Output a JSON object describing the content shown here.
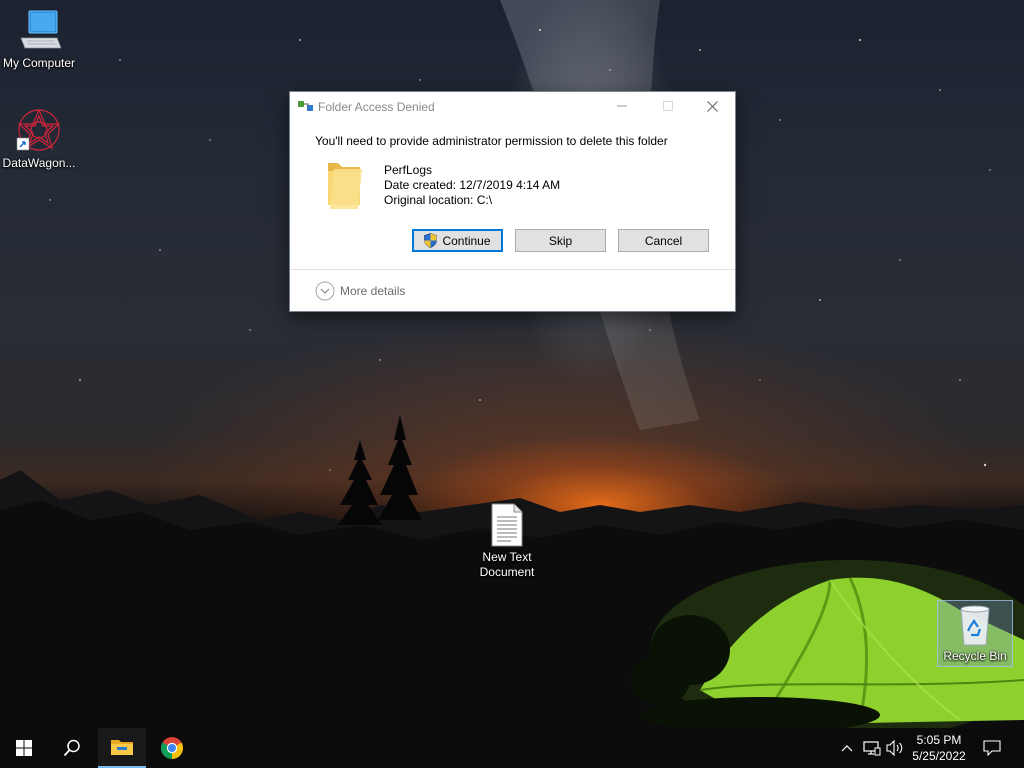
{
  "desktop": {
    "icons": [
      {
        "label": "My Computer",
        "icon": "computer-icon"
      },
      {
        "label": "DataWagon...",
        "icon": "datawagon-shortcut-icon"
      },
      {
        "label": "New Text Document",
        "label_line1": "New Text",
        "label_line2": "Document",
        "icon": "text-document-icon"
      },
      {
        "label": "Recycle Bin",
        "icon": "recycle-bin-icon",
        "selected": true
      }
    ]
  },
  "dialog": {
    "title": "Folder Access Denied",
    "message": "You'll need to provide administrator permission to delete this folder",
    "item": {
      "name": "PerfLogs",
      "date_created": "Date created: 12/7/2019 4:14 AM",
      "original_location": "Original location: C:\\"
    },
    "buttons": {
      "continue": "Continue",
      "skip": "Skip",
      "cancel": "Cancel"
    },
    "more_details": "More details",
    "colors": {
      "accent": "#0078d7"
    }
  },
  "taskbar": {
    "pinned": [
      "start-icon",
      "search-icon",
      "file-explorer-icon",
      "chrome-icon"
    ],
    "active_app": "file-explorer",
    "clock": {
      "time": "5:05 PM",
      "date": "5/25/2022"
    }
  }
}
